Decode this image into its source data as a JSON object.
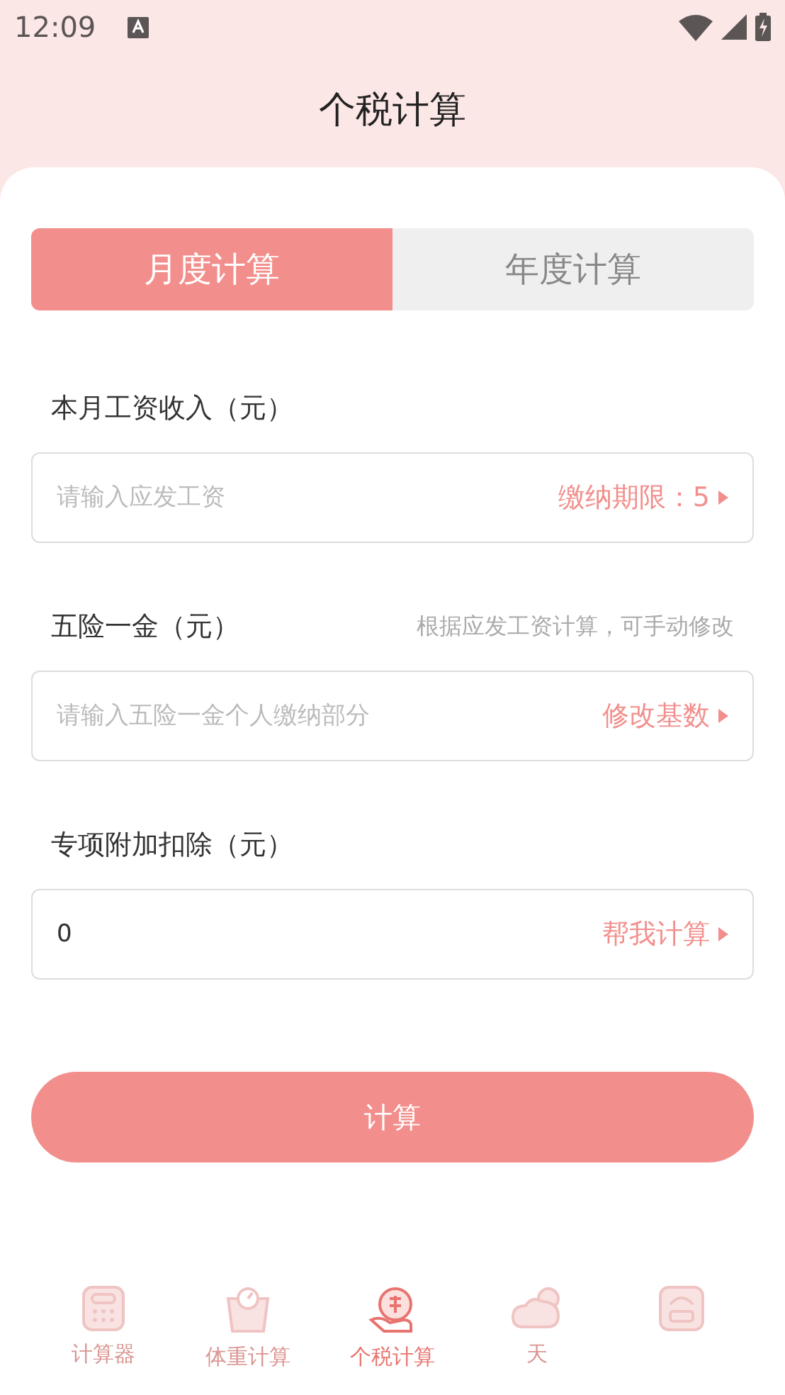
{
  "status_bar": {
    "time": "12:09"
  },
  "title": "个税计算",
  "tabs": [
    {
      "label": "月度计算",
      "selected": true
    },
    {
      "label": "年度计算",
      "selected": false
    }
  ],
  "fields": [
    {
      "label": "本月工资收入（元）",
      "placeholder": "请输入应发工资",
      "action": "缴纳期限：5"
    },
    {
      "label": "五险一金（元）",
      "hint": "根据应发工资计算，可手动修改",
      "placeholder": "请输入五险一金个人缴纳部分",
      "action": "修改基数"
    },
    {
      "label": "专项附加扣除（元）",
      "value": "0",
      "action": "帮我计算"
    }
  ],
  "submit": "计算",
  "nav": [
    {
      "kind": "calculator",
      "label": "计算器",
      "selected": false
    },
    {
      "kind": "scale",
      "label": "体重计算",
      "selected": false
    },
    {
      "kind": "tax",
      "label": "个税计算",
      "selected": true
    },
    {
      "kind": "weather",
      "label": "天",
      "selected": false
    },
    {
      "kind": "bmi",
      "selected": false
    }
  ]
}
